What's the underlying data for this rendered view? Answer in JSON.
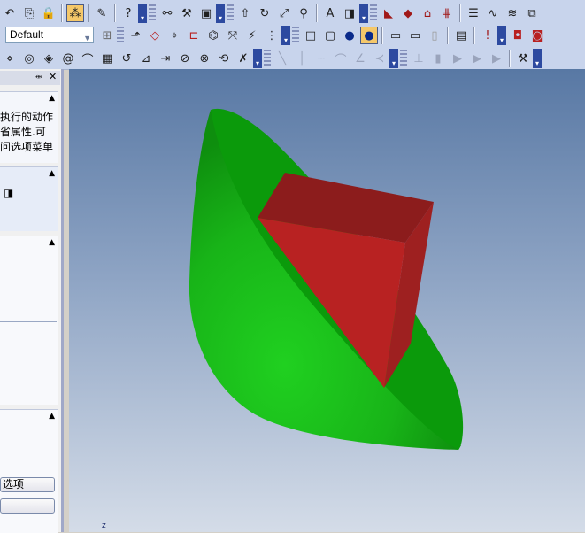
{
  "toolbar": {
    "style_combo_value": "Default"
  },
  "panel": {
    "pin_glyph": "⬺",
    "close_glyph": "✕",
    "description_lines": [
      "执行的动作",
      "省属性.可",
      "问选项菜单"
    ],
    "button1_label": "选项",
    "button2_label": ""
  },
  "viewport": {
    "axis_label": "z",
    "colors": {
      "cone": "#1fb41f",
      "cone_cap": "#0a9c0a",
      "prism_front": "#b82020",
      "prism_top": "#8c1c1c",
      "prism_side": "#9e2020"
    }
  }
}
